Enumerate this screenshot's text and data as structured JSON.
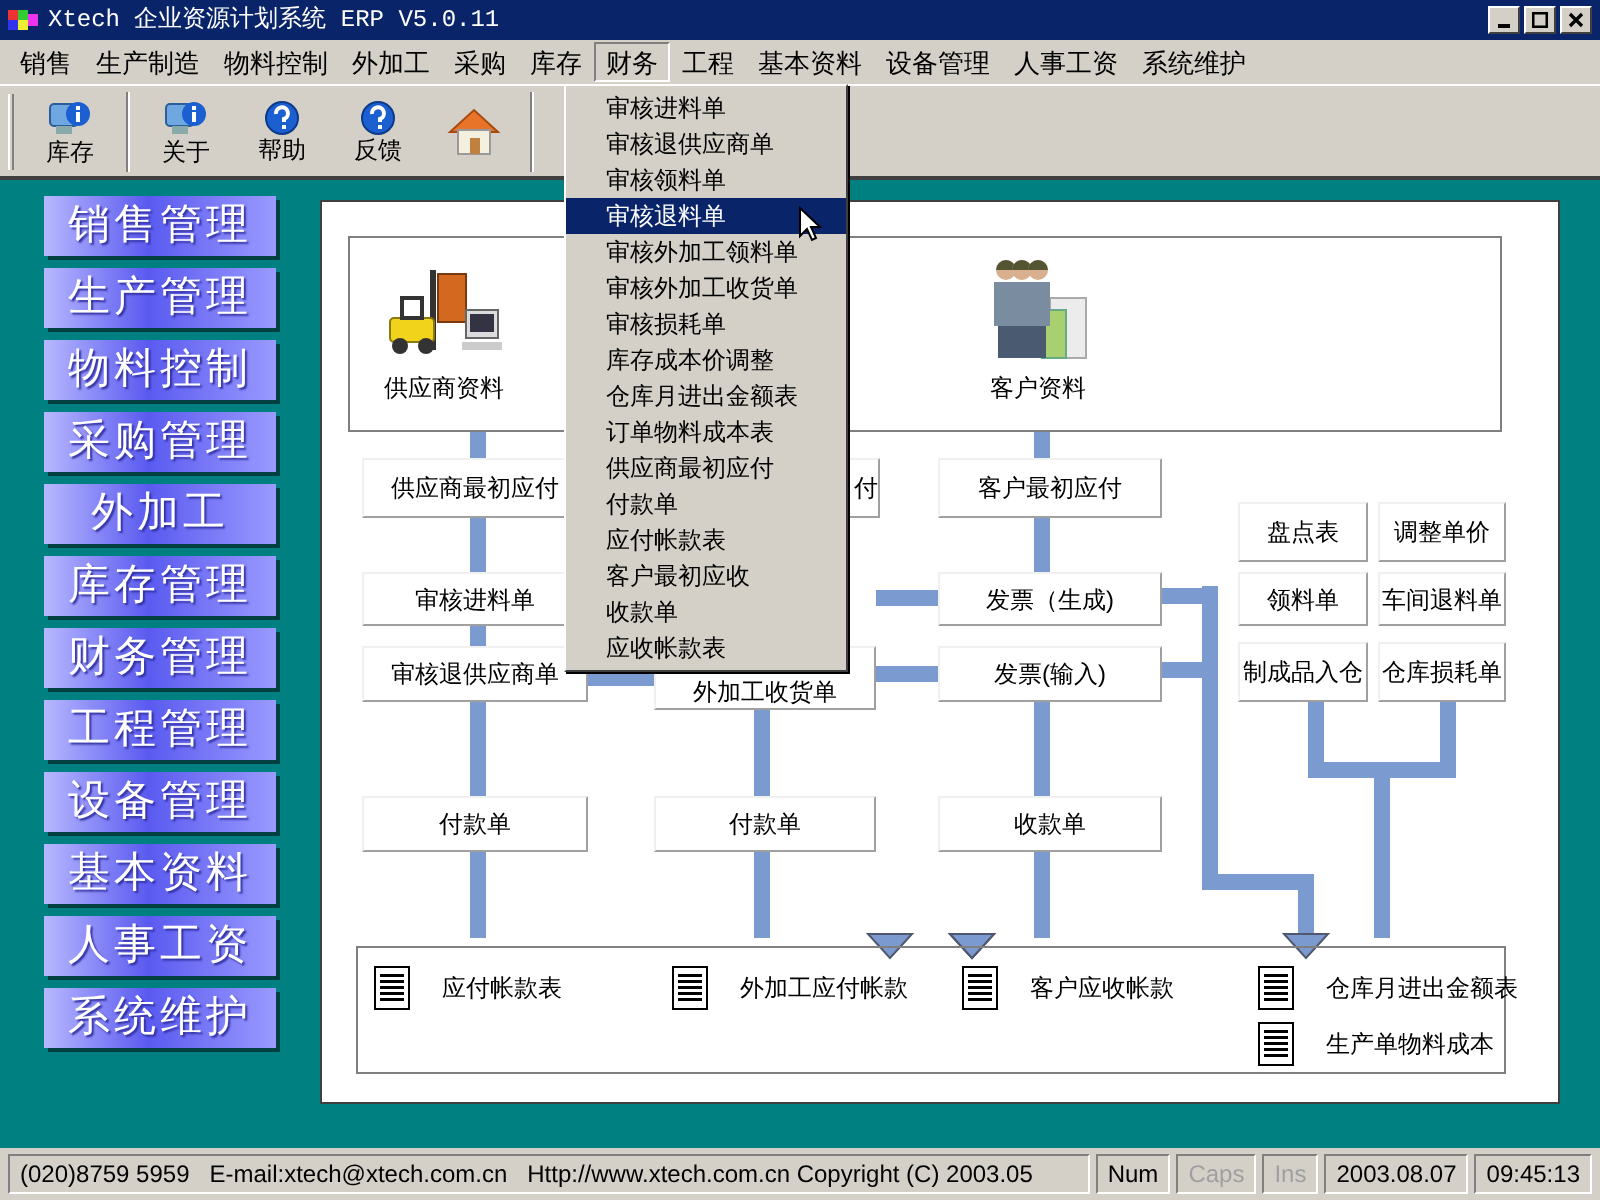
{
  "window": {
    "title": "Xtech 企业资源计划系统 ERP V5.0.11"
  },
  "menu_bar": [
    {
      "label": "销售",
      "selected": false
    },
    {
      "label": "生产制造",
      "selected": false
    },
    {
      "label": "物料控制",
      "selected": false
    },
    {
      "label": "外加工",
      "selected": false
    },
    {
      "label": "采购",
      "selected": false
    },
    {
      "label": "库存",
      "selected": false
    },
    {
      "label": "财务",
      "selected": true
    },
    {
      "label": "工程",
      "selected": false
    },
    {
      "label": "基本资料",
      "selected": false
    },
    {
      "label": "设备管理",
      "selected": false
    },
    {
      "label": "人事工资",
      "selected": false
    },
    {
      "label": "系统维护",
      "selected": false
    }
  ],
  "dropdown": {
    "items": [
      {
        "label": "审核进料单",
        "selected": false
      },
      {
        "label": "审核退供应商单",
        "selected": false
      },
      {
        "label": "审核领料单",
        "selected": false
      },
      {
        "label": "审核退料单",
        "selected": true
      },
      {
        "label": "审核外加工领料单",
        "selected": false
      },
      {
        "label": "审核外加工收货单",
        "selected": false
      },
      {
        "label": "审核损耗单",
        "selected": false
      },
      {
        "label": "库存成本价调整",
        "selected": false
      },
      {
        "label": "仓库月进出金额表",
        "selected": false
      },
      {
        "label": "订单物料成本表",
        "selected": false
      },
      {
        "label": "供应商最初应付",
        "selected": false
      },
      {
        "label": "付款单",
        "selected": false
      },
      {
        "label": "应付帐款表",
        "selected": false
      },
      {
        "label": "客户最初应收",
        "selected": false
      },
      {
        "label": "收款单",
        "selected": false
      },
      {
        "label": "应收帐款表",
        "selected": false
      }
    ]
  },
  "toolbar": {
    "buttons": [
      {
        "label": "库存",
        "kind": "info"
      },
      {
        "label": "关于",
        "kind": "info"
      },
      {
        "label": "帮助",
        "kind": "help"
      },
      {
        "label": "反馈",
        "kind": "help"
      },
      {
        "kind": "home"
      }
    ]
  },
  "sidebar": {
    "items": [
      "销售管理",
      "生产管理",
      "物料控制",
      "采购管理",
      "外加工",
      "库存管理",
      "财务管理",
      "工程管理",
      "设备管理",
      "基本资料",
      "人事工资",
      "系统维护"
    ]
  },
  "diagram": {
    "sources": [
      {
        "label": "供应商资料",
        "kind": "supplier"
      },
      {
        "label": "客户资料",
        "kind": "customer"
      }
    ],
    "nodes": [
      "供应商最初应付",
      "审核进料单",
      "审核退供应商单",
      "付款单",
      "付",
      "外加工收货单",
      "付款单",
      "客户最初应付",
      "发票（生成)",
      "发票(输入)",
      "收款单",
      "盘点表",
      "调整单价",
      "领料单",
      "车间退料单",
      "制成品入仓",
      "仓库损耗单"
    ],
    "reports": [
      "应付帐款表",
      "外加工应付帐款",
      "客户应收帐款",
      "仓库月进出金额表",
      "生产单物料成本"
    ]
  },
  "status_bar": [
    {
      "text": "(020)8759 5959   E-mail:xtech@xtech.com.cn   Http://www.xtech.com.cn Copyright (C) 2003.05",
      "disabled": false
    },
    {
      "text": "Num",
      "disabled": false
    },
    {
      "text": "Caps",
      "disabled": true
    },
    {
      "text": "Ins",
      "disabled": true
    },
    {
      "text": "2003.08.07",
      "disabled": false
    },
    {
      "text": "09:45:13",
      "disabled": false
    }
  ]
}
